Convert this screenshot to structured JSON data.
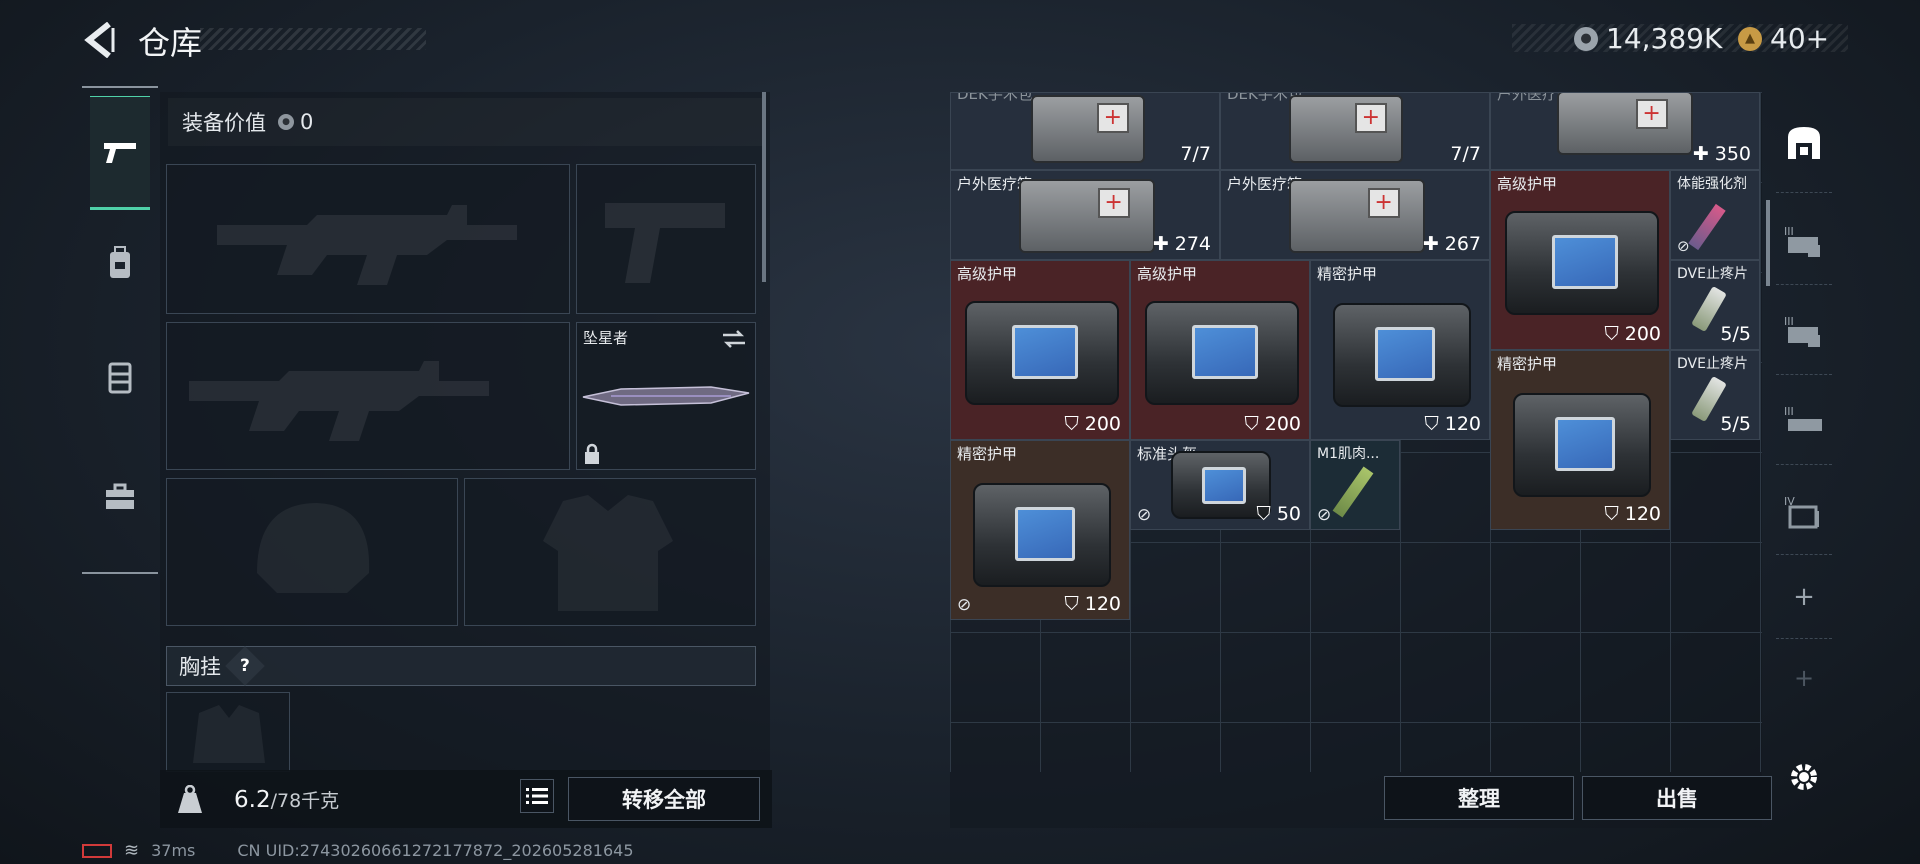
{
  "header": {
    "title": "仓库",
    "currency": [
      {
        "icon": "silver-coin-icon",
        "value": "14,389K"
      },
      {
        "icon": "gold-coin-icon",
        "value": "40+"
      }
    ]
  },
  "equipment": {
    "value_label": "装备价值",
    "value": "0",
    "melee_name": "坠星者",
    "section_label": "胸挂",
    "help": "?",
    "weight_current": "6.2",
    "weight_max": "/78千克",
    "transfer_all": "转移全部"
  },
  "left_tabs": [
    "pistol-icon",
    "backpack-icon",
    "container-icon",
    "briefcase-icon"
  ],
  "inventory": {
    "top_partial": [
      {
        "name": "DEK手术包",
        "val": "7/7"
      },
      {
        "name": "DEK手术包",
        "val": "7/7"
      },
      {
        "name": "户外医疗箱",
        "val": "350"
      }
    ],
    "items": [
      {
        "name": "户外医疗箱",
        "val": "274"
      },
      {
        "name": "户外医疗箱",
        "val": "267"
      },
      {
        "name": "高级护甲",
        "val": "200"
      },
      {
        "name": "体能强化剂",
        "val": ""
      },
      {
        "name": "高级护甲",
        "val": "200"
      },
      {
        "name": "高级护甲",
        "val": "200"
      },
      {
        "name": "精密护甲",
        "val": "120"
      },
      {
        "name": "DVE止疼片",
        "val": "5/5"
      },
      {
        "name": "精密护甲",
        "val": "120"
      },
      {
        "name": "DVE止疼片",
        "val": "5/5"
      },
      {
        "name": "精密护甲",
        "val": "120"
      },
      {
        "name": "标准头盔",
        "val": "50"
      },
      {
        "name": "M1肌肉...",
        "val": ""
      }
    ]
  },
  "buttons": {
    "sort": "整理",
    "sell": "出售"
  },
  "status": {
    "ping": "37ms",
    "uid": "CN UID:27430260661272177872_202605281645"
  }
}
